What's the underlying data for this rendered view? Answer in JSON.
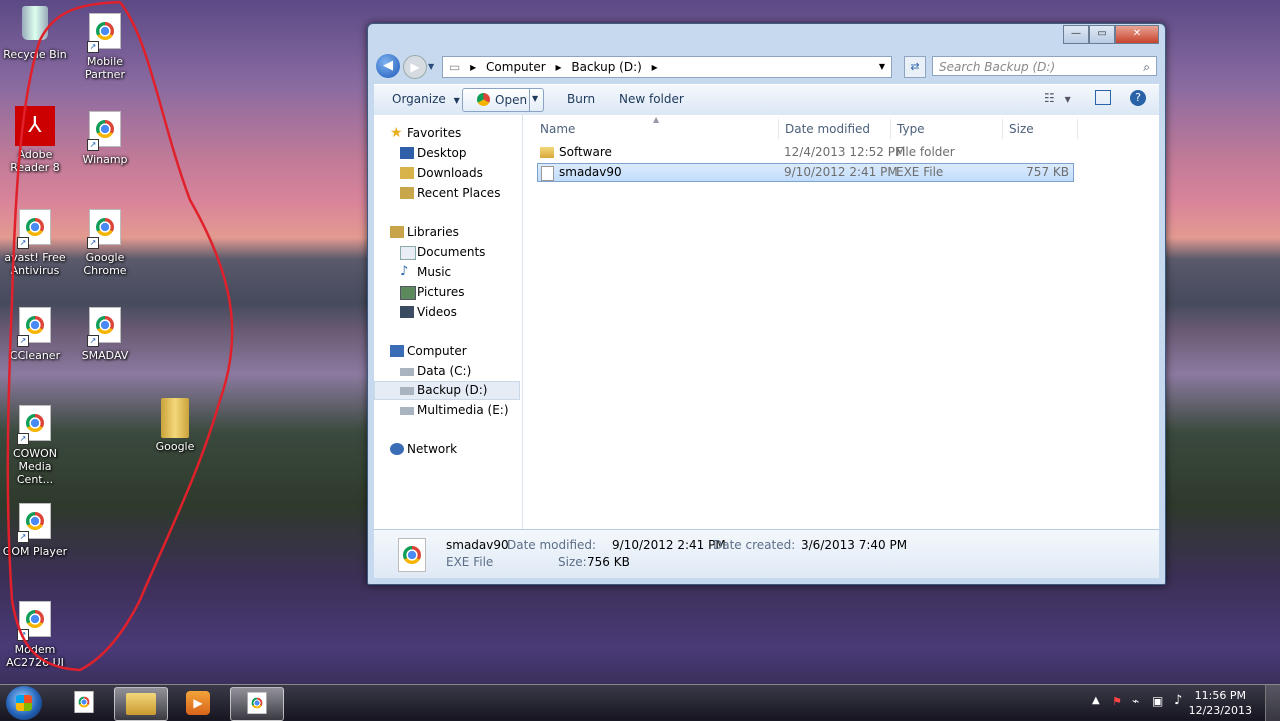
{
  "desktop": {
    "icons": [
      {
        "label": "Recycle Bin"
      },
      {
        "label": "Mobile Partner"
      },
      {
        "label": "Adobe Reader 8"
      },
      {
        "label": "Winamp"
      },
      {
        "label": "avast! Free Antivirus"
      },
      {
        "label": "Google Chrome"
      },
      {
        "label": "CCleaner"
      },
      {
        "label": "SMADAV"
      },
      {
        "label": "COWON Media Cent..."
      },
      {
        "label": "Google"
      },
      {
        "label": "GOM Player"
      },
      {
        "label": "Modem AC2726 UI"
      }
    ]
  },
  "explorer": {
    "address": {
      "segments": [
        "Computer",
        "Backup (D:)"
      ],
      "separator": "▸"
    },
    "search_placeholder": "Search Backup (D:)",
    "toolbar": {
      "organize": "Organize",
      "open": "Open",
      "burn": "Burn",
      "new_folder": "New folder"
    },
    "nav": {
      "favorites": "Favorites",
      "desktop": "Desktop",
      "downloads": "Downloads",
      "recent": "Recent Places",
      "libraries": "Libraries",
      "documents": "Documents",
      "music": "Music",
      "pictures": "Pictures",
      "videos": "Videos",
      "computer": "Computer",
      "data_c": "Data (C:)",
      "backup_d": "Backup (D:)",
      "multimedia_e": "Multimedia (E:)",
      "network": "Network"
    },
    "columns": {
      "name": "Name",
      "date": "Date modified",
      "type": "Type",
      "size": "Size"
    },
    "files": [
      {
        "name": "Software",
        "date": "12/4/2013 12:52 PM",
        "type": "File folder",
        "size": ""
      },
      {
        "name": "smadav90",
        "date": "9/10/2012 2:41 PM",
        "type": "EXE File",
        "size": "757 KB"
      }
    ],
    "details": {
      "name": "smadav90",
      "type": "EXE File",
      "modified_label": "Date modified:",
      "modified_value": "9/10/2012 2:41 PM",
      "created_label": "Date created:",
      "created_value": "3/6/2013 7:40 PM",
      "size_label": "Size:",
      "size_value": "756 KB"
    }
  },
  "taskbar": {
    "time": "11:56 PM",
    "date": "12/23/2013"
  }
}
